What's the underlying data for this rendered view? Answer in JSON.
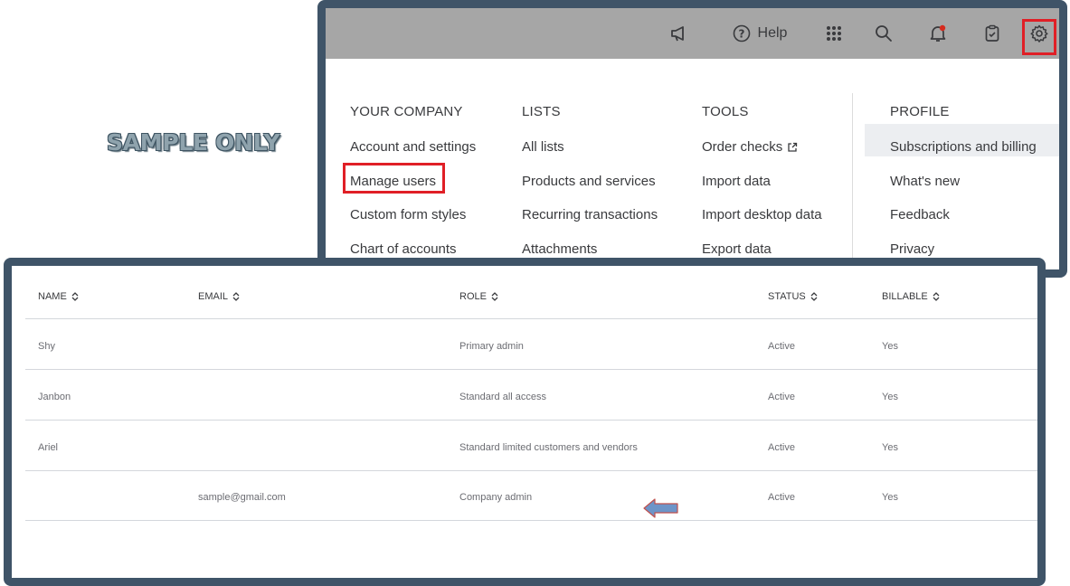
{
  "watermark": "SAMPLE ONLY",
  "topbar": {
    "icons": [
      "megaphone-icon",
      "help-icon",
      "apps-grid-icon",
      "search-icon",
      "notifications-icon",
      "tasks-clipboard-icon",
      "gear-icon"
    ],
    "help_label": "Help"
  },
  "menu": {
    "columns": [
      {
        "heading": "YOUR COMPANY",
        "items": [
          "Account and settings",
          "Manage users",
          "Custom form styles",
          "Chart of accounts"
        ]
      },
      {
        "heading": "LISTS",
        "items": [
          "All lists",
          "Products and services",
          "Recurring transactions",
          "Attachments"
        ]
      },
      {
        "heading": "TOOLS",
        "items": [
          "Order checks",
          "Import data",
          "Import desktop data",
          "Export data"
        ]
      },
      {
        "heading": "PROFILE",
        "items": [
          "Subscriptions and billing",
          "What's new",
          "Feedback",
          "Privacy"
        ]
      }
    ]
  },
  "table": {
    "headers": [
      "NAME",
      "EMAIL",
      "ROLE",
      "STATUS",
      "BILLABLE"
    ],
    "rows": [
      [
        "Shy",
        "",
        "Primary admin",
        "Active",
        "Yes"
      ],
      [
        "Janbon",
        "",
        "Standard all access",
        "Active",
        "Yes"
      ],
      [
        "Ariel",
        "",
        "Standard limited customers and vendors",
        "Active",
        "Yes"
      ],
      [
        "",
        "sample@gmail.com",
        "Company admin",
        "Active",
        "Yes"
      ]
    ]
  },
  "colors": {
    "frame": "#3f5468",
    "highlight": "#e01f26",
    "topbar": "#a6a6a6",
    "arrow": "#6d94c8"
  }
}
